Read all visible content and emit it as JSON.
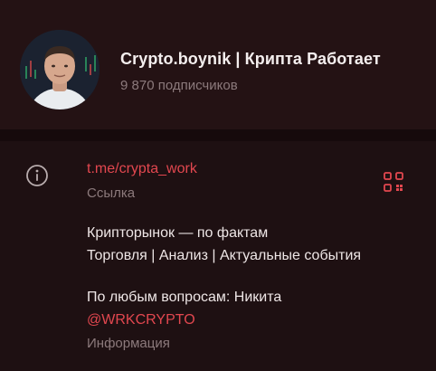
{
  "channel": {
    "name": "Crypto.boynik | Крипта Работает",
    "subscribers": "9 870 подписчиков"
  },
  "link": {
    "url": "t.me/crypta_work",
    "caption": "Ссылка"
  },
  "description": {
    "lines": [
      "Крипторынок — по фактам",
      "Торговля | Анализ | Актуальные события",
      "По любым вопросам: Никита"
    ],
    "mention": "@WRKCRYPTO",
    "caption": "Информация"
  },
  "icons": {
    "info": "info-circle-icon",
    "qr": "qr-code-icon"
  },
  "colors": {
    "accent": "#e2474f",
    "background": "#1e1012",
    "header_background": "#241214",
    "muted_text": "#8c7a7c"
  }
}
